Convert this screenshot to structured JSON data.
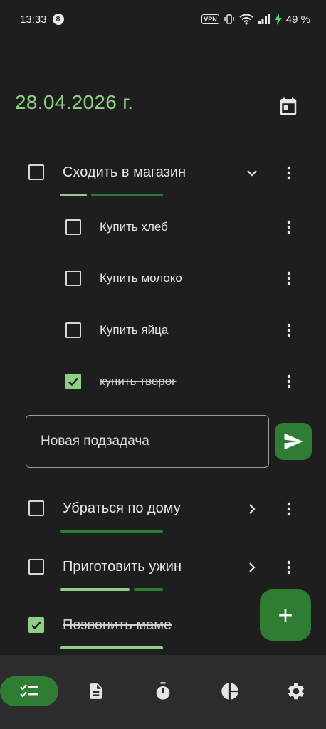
{
  "status_bar": {
    "time": "13:33",
    "notification_count": "8",
    "vpn_label": "VPN",
    "battery": "49 %"
  },
  "header": {
    "date": "28.04.2026 г."
  },
  "tasks": [
    {
      "label": "Сходить в магазин",
      "checked": false,
      "expanded": true,
      "subtasks": [
        {
          "label": "Купить хлеб",
          "checked": false
        },
        {
          "label": "Купить молоко",
          "checked": false
        },
        {
          "label": "Купить яйца",
          "checked": false
        },
        {
          "label": "купить творог",
          "checked": true
        }
      ]
    },
    {
      "label": "Убраться по дому",
      "checked": false,
      "expanded": false
    },
    {
      "label": "Приготовить ужин",
      "checked": false,
      "expanded": false
    },
    {
      "label": "Позвонить маме",
      "checked": true
    }
  ],
  "subtask_input": {
    "placeholder": "Новая подзадача"
  },
  "fab": {
    "label": "+"
  },
  "bottom_nav": {
    "items": [
      "tasks-icon",
      "notes-icon",
      "timer-icon",
      "stats-icon",
      "settings-icon"
    ],
    "active": "tasks-icon"
  },
  "colors": {
    "accent": "#8ecf86",
    "primary_dark": "#2e7d32",
    "background": "#1e1e1f",
    "nav_background": "#2c2c2e"
  }
}
